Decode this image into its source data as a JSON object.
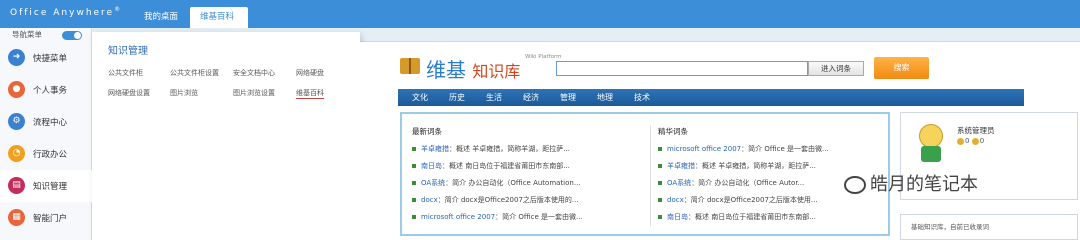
{
  "app": {
    "logo": "Office Anywhere",
    "logo_mark": "®"
  },
  "tabs": [
    {
      "label": "我的桌面"
    },
    {
      "label": "维基百科",
      "close": "×"
    }
  ],
  "nav": {
    "toggle_label": "导航菜单",
    "items": [
      {
        "label": "快捷菜单",
        "color": "#3a82d0"
      },
      {
        "label": "个人事务",
        "color": "#e8663b"
      },
      {
        "label": "流程中心",
        "color": "#3a82d0"
      },
      {
        "label": "行政办公",
        "color": "#f0a020"
      },
      {
        "label": "知识管理",
        "color": "#c42c5a"
      },
      {
        "label": "智能门户",
        "color": "#e8663b"
      }
    ]
  },
  "panel": {
    "title": "知识管理",
    "links": [
      "公共文件柜",
      "公共文件柜设置",
      "安全文档中心",
      "网络硬盘",
      "网络硬盘设置",
      "图片浏览",
      "图片浏览设置",
      "维基百科"
    ]
  },
  "wiki": {
    "brand_a": "维基",
    "brand_b": "知识库",
    "platform": "Wiki Platform",
    "enter_button": "进入词条",
    "search_button": "搜索",
    "categories": [
      "文化",
      "历史",
      "生活",
      "经济",
      "管理",
      "地理",
      "技术"
    ],
    "latest_title": "最新词条",
    "featured_title": "精华词条",
    "latest": [
      {
        "t": "羊卓雍措",
        "d": "：概述 羊卓雍措，简称羊湖，距拉萨..."
      },
      {
        "t": "南日岛",
        "d": "：概述 南日岛位于福建省莆田市东南部..."
      },
      {
        "t": "OA系统",
        "d": "：简介 办公自动化（Office Automation..."
      },
      {
        "t": "docx",
        "d": "：简介 docx是Office2007之后版本使用的..."
      },
      {
        "t": "microsoft office 2007",
        "d": "：简介 Office 是一套由微..."
      }
    ],
    "featured": [
      {
        "t": "microsoft office 2007",
        "d": "：简介 Office 是一套由微..."
      },
      {
        "t": "羊卓雍措",
        "d": "：概述 羊卓雍措，简称羊湖，距拉萨..."
      },
      {
        "t": "OA系统",
        "d": "：简介 办公自动化（Office Autor..."
      },
      {
        "t": "docx",
        "d": "：简介 docx是Office2007之后版本使用..."
      },
      {
        "t": "南日岛",
        "d": "：概述 南日岛位于福建省莆田市东南部..."
      }
    ],
    "user_name": "系统管理员",
    "medal_a": "0",
    "medal_b": "0",
    "knowledge_note": "基础知识库，自前已收录词"
  },
  "watermark": "皓月的笔记本"
}
